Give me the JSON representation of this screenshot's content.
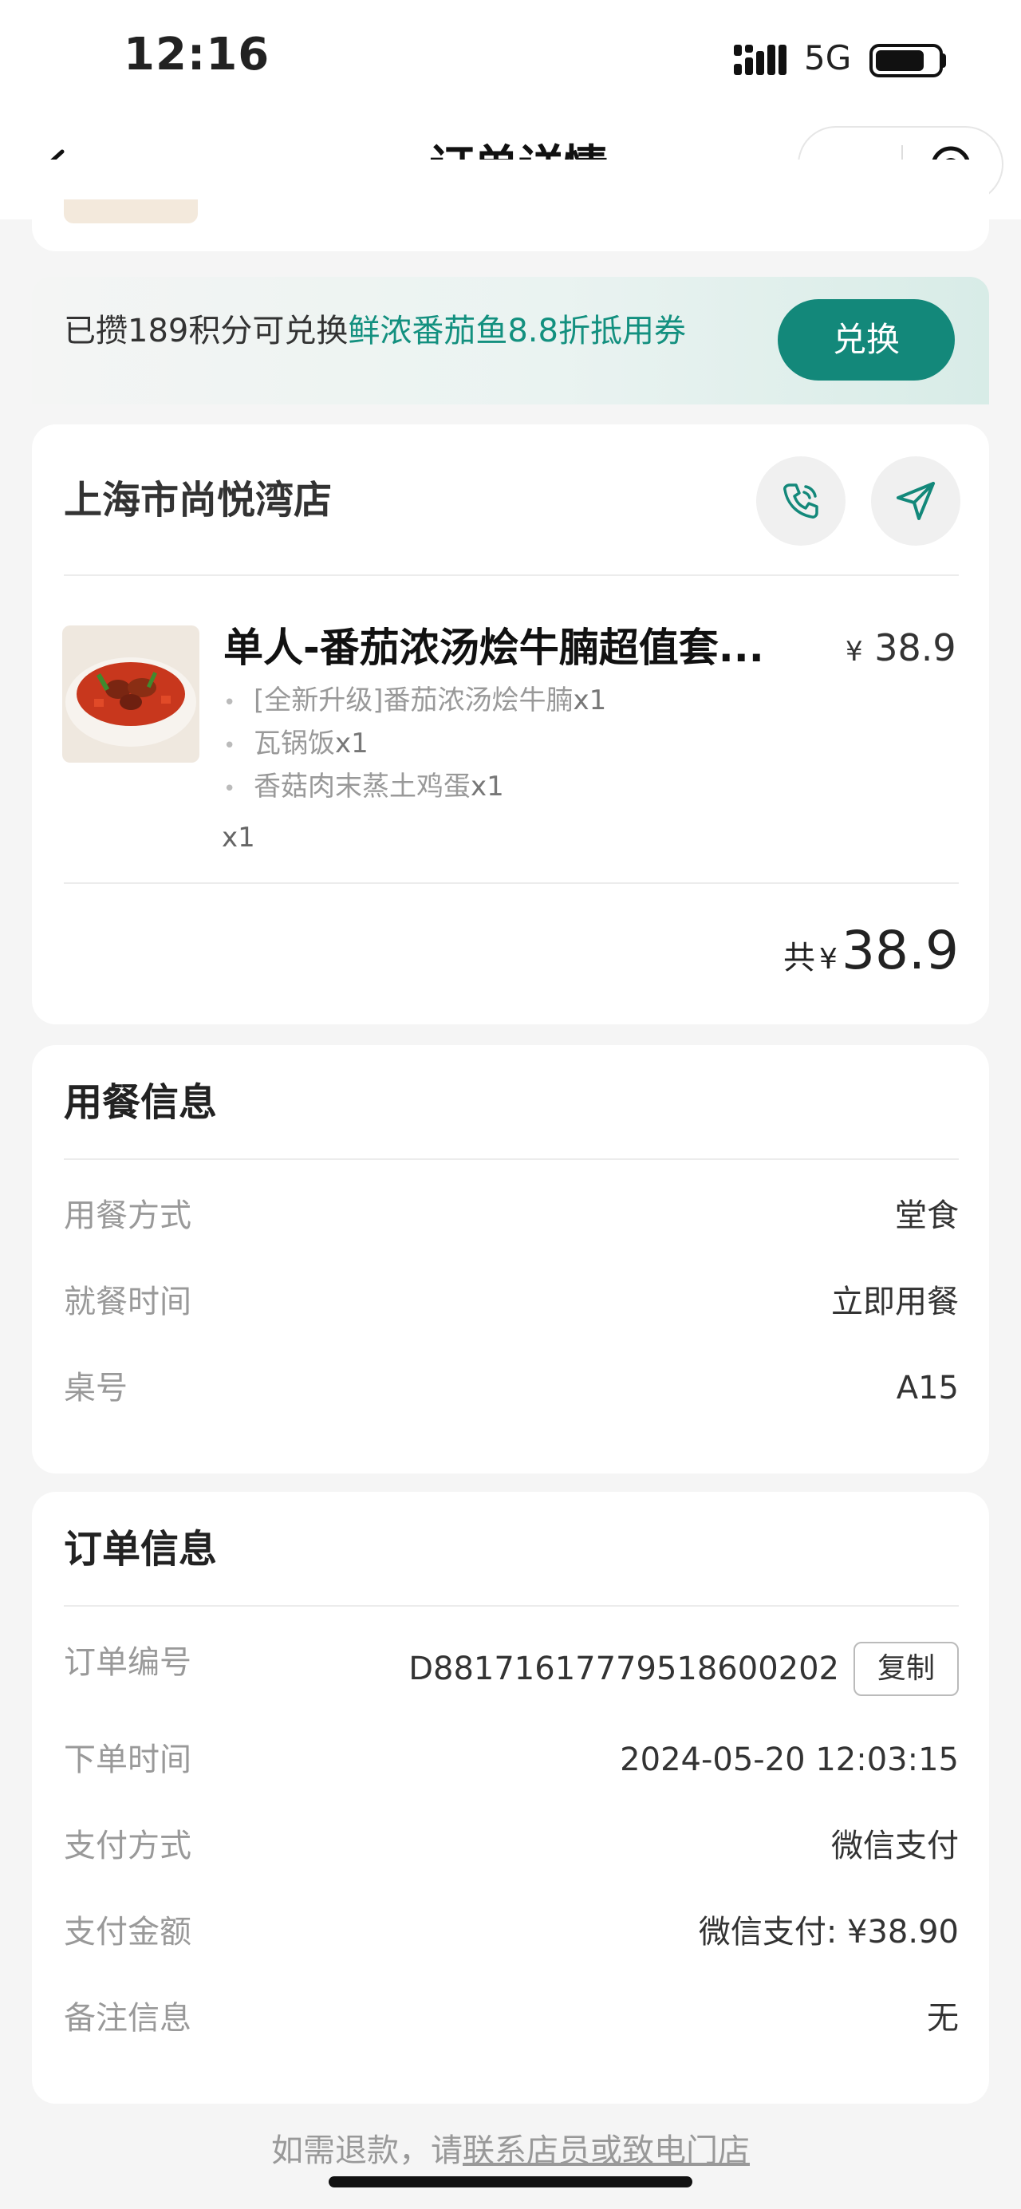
{
  "status_bar": {
    "time": "12:16",
    "network": "5G"
  },
  "nav": {
    "title": "订单详情"
  },
  "points_banner": {
    "text_prefix": "已攒189积分可兑换",
    "text_highlight": "鲜浓番茄鱼8.8折抵用券",
    "button": "兑换"
  },
  "store": {
    "name": "上海市尚悦湾店",
    "item": {
      "name": "单人-番茄浓汤烩牛腩超值套...",
      "price_symbol": "¥",
      "price": "38.9",
      "sub_items": [
        {
          "name": "[全新升级]番茄浓汤烩牛腩",
          "qty": "x1"
        },
        {
          "name": "瓦锅饭",
          "qty": "x1"
        },
        {
          "name": "香菇肉末蒸土鸡蛋",
          "qty": "x1"
        }
      ],
      "qty": "x1"
    },
    "total_label": "共",
    "total_symbol": "¥",
    "total": "38.9"
  },
  "dining_info": {
    "title": "用餐信息",
    "rows": [
      {
        "label": "用餐方式",
        "value": "堂食"
      },
      {
        "label": "就餐时间",
        "value": "立即用餐"
      },
      {
        "label": "桌号",
        "value": "A15"
      }
    ]
  },
  "order_info": {
    "title": "订单信息",
    "order_no_label": "订单编号",
    "order_no": "D88171617779518600202",
    "copy_button": "复制",
    "rows": [
      {
        "label": "下单时间",
        "value": "2024-05-20 12:03:15"
      },
      {
        "label": "支付方式",
        "value": "微信支付"
      },
      {
        "label": "支付金额",
        "value": "微信支付: ¥38.90"
      },
      {
        "label": "备注信息",
        "value": "无"
      }
    ]
  },
  "footer": {
    "prefix": "如需退款，请",
    "link": "联系店员或致电门店"
  },
  "colors": {
    "accent": "#13887a",
    "highlight": "#13907f"
  }
}
